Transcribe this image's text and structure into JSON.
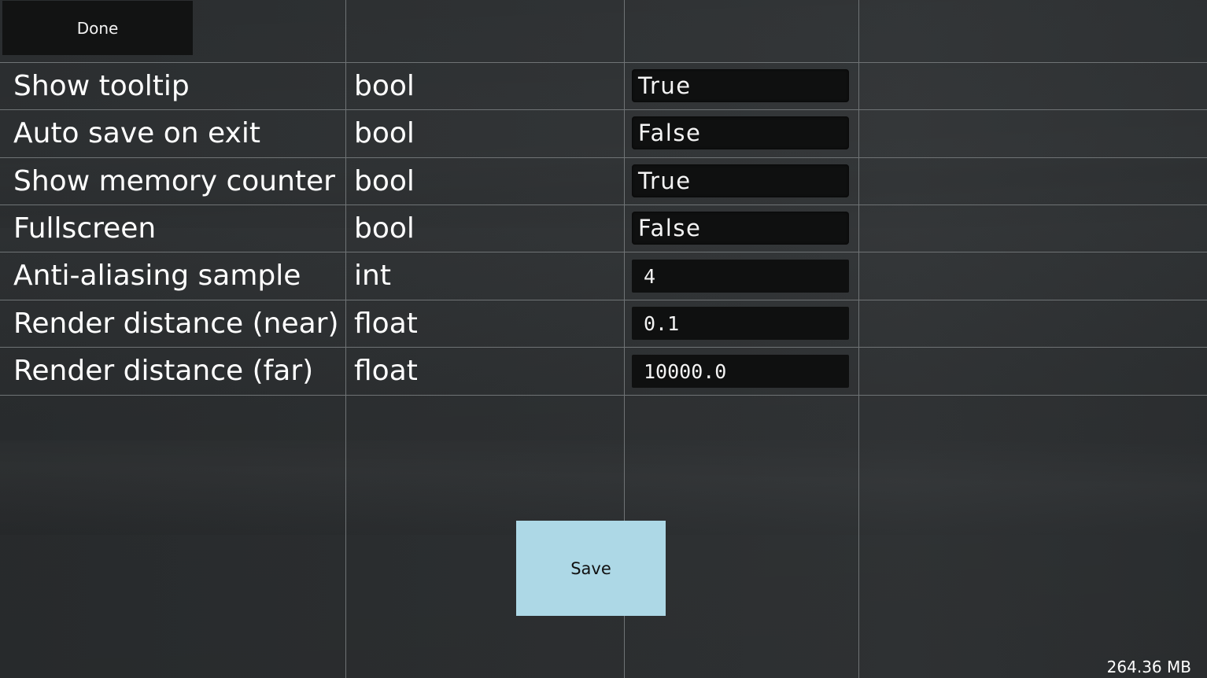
{
  "toolbar": {
    "done_label": "Done"
  },
  "settings": [
    {
      "name": "Show tooltip",
      "type": "bool",
      "value": "True",
      "kind": "toggle"
    },
    {
      "name": "Auto save on exit",
      "type": "bool",
      "value": "False",
      "kind": "toggle"
    },
    {
      "name": "Show memory counter",
      "type": "bool",
      "value": "True",
      "kind": "toggle"
    },
    {
      "name": "Fullscreen",
      "type": "bool",
      "value": "False",
      "kind": "toggle"
    },
    {
      "name": "Anti-aliasing sample",
      "type": "int",
      "value": "4",
      "kind": "text"
    },
    {
      "name": "Render distance (near)",
      "type": "float",
      "value": "0.1",
      "kind": "text"
    },
    {
      "name": "Render distance (far)",
      "type": "float",
      "value": "10000.0",
      "kind": "text"
    }
  ],
  "footer": {
    "save_label": "Save",
    "memory_counter": "264.36 MB"
  },
  "colors": {
    "save_button": "#add8e6",
    "done_button": "#121313",
    "grid_line": "#6f7375",
    "value_box": "#0f1010"
  }
}
